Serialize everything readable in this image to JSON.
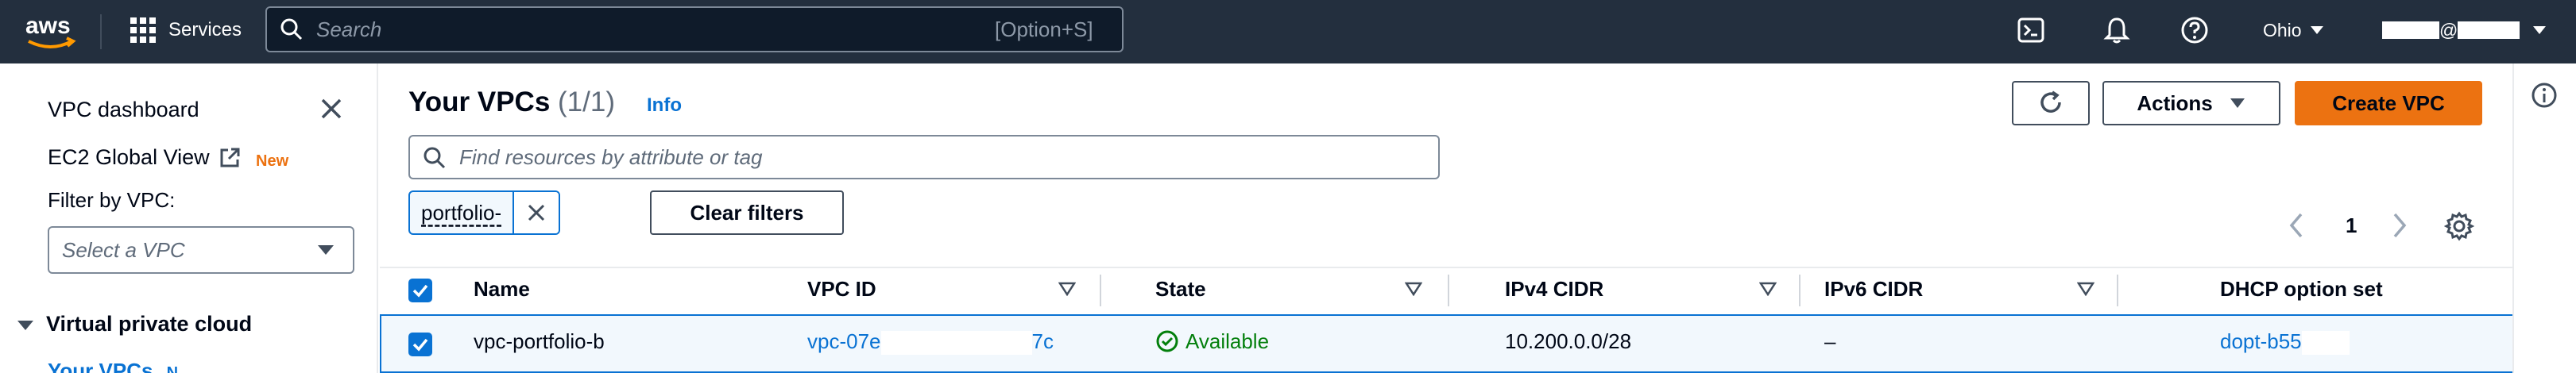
{
  "topnav": {
    "logo_text": "aws",
    "services_label": "Services",
    "search_placeholder": "Search",
    "search_shortcut": "[Option+S]",
    "region": "Ohio",
    "account_separator": "@",
    "icons": [
      "grid-icon",
      "search-icon",
      "cloudshell-icon",
      "bell-icon",
      "help-icon",
      "caret-down-icon"
    ]
  },
  "sidebar": {
    "dashboard_label": "VPC dashboard",
    "global_view_label": "EC2 Global View",
    "new_badge": "New",
    "filter_label": "Filter by VPC:",
    "filter_select": "Select a VPC",
    "section_title": "Virtual private cloud",
    "your_vpcs_label": "Your VPCs",
    "your_vpcs_badge": "N"
  },
  "main": {
    "title": "Your VPCs",
    "count": "(1/1)",
    "info_label": "Info",
    "actions_label": "Actions",
    "create_label": "Create VPC",
    "filter_placeholder": "Find resources by attribute or tag",
    "filter_token": "portfolio-",
    "clear_filters_label": "Clear filters",
    "page_number": "1"
  },
  "table": {
    "columns": [
      "Name",
      "VPC ID",
      "State",
      "IPv4 CIDR",
      "IPv6 CIDR",
      "DHCP option set"
    ],
    "rows": [
      {
        "selected": true,
        "name": "vpc-portfolio-b",
        "vpc_id_start": "vpc-07e",
        "vpc_id_end": "7c",
        "state": "Available",
        "ipv4_cidr": "10.200.0.0/28",
        "ipv6_cidr": "–",
        "dhcp_option_set": "dopt-b55"
      }
    ]
  },
  "colors": {
    "nav_bg": "#232f3e",
    "accent_orange": "#ec7211",
    "link_blue": "#0972d3",
    "status_green": "#037f0c"
  }
}
